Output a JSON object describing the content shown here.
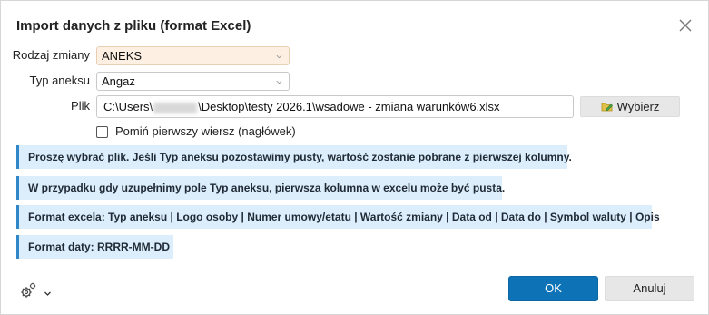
{
  "dialog": {
    "title": "Import danych z pliku (format Excel)"
  },
  "form": {
    "rodzaj_label": "Rodzaj zmiany",
    "rodzaj_value": "ANEKS",
    "typ_label": "Typ aneksu",
    "typ_value": "Angaz",
    "plik_label": "Plik",
    "plik_prefix": "C:\\Users\\",
    "plik_suffix": "\\Desktop\\testy 2026.1\\wsadowe - zmiana warunków6.xlsx",
    "wybierz_label": "Wybierz",
    "checkbox_label": "Pomiń pierwszy wiersz (nagłówek)",
    "checkbox_checked": false
  },
  "info": [
    "Proszę wybrać plik. Jeśli Typ aneksu pozostawimy pusty, wartość zostanie pobrane z pierwszej kolumny.",
    "W przypadku gdy uzupełnimy pole Typ aneksu, pierwsza kolumna w excelu może być pusta.",
    "Format excela: Typ aneksu | Logo osoby | Numer umowy/etatu | Wartość zmiany | Data od | Data do | Symbol waluty | Opis",
    "Format daty: RRRR-MM-DD"
  ],
  "footer": {
    "ok_label": "OK",
    "cancel_label": "Anuluj"
  },
  "icons": {
    "close": "close-icon",
    "chevron": "chevron-down-icon",
    "wybierz": "pencil-folder-icon",
    "settings": "gear-icon"
  },
  "colors": {
    "accent": "#0e72b7",
    "info_bg": "#dceefb",
    "info_border": "#2f86c8",
    "highlight_select": "#fdf0e3"
  }
}
